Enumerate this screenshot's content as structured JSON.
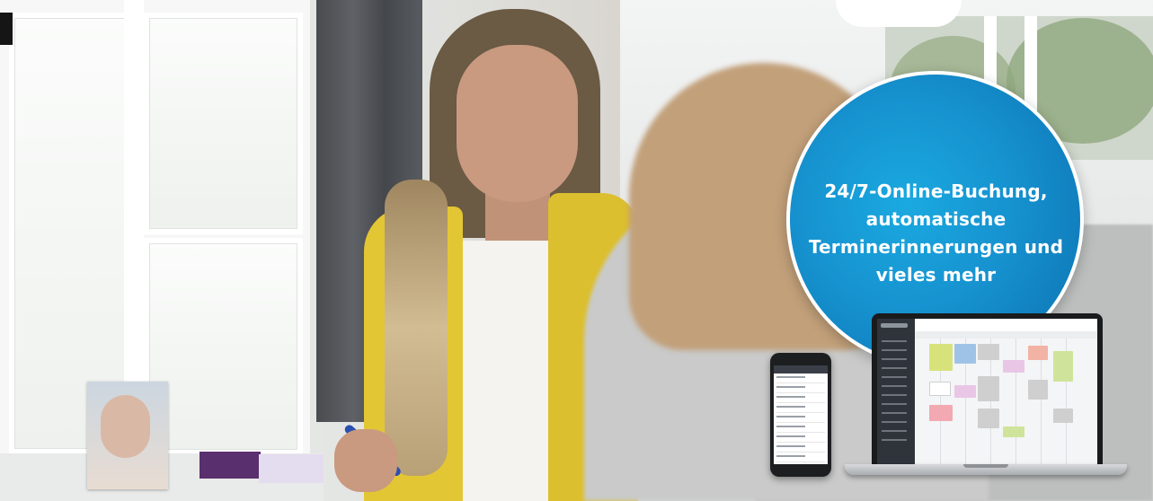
{
  "promo": {
    "headline_lines": [
      "24/7-Online-Buchung,",
      "automatische",
      "Terminerinnerungen und",
      "vieles mehr"
    ],
    "circle_color": "#1692cf",
    "text_color": "#ffffff"
  },
  "devices": {
    "phone": "smartphone-mockup",
    "laptop": "laptop-mockup"
  }
}
